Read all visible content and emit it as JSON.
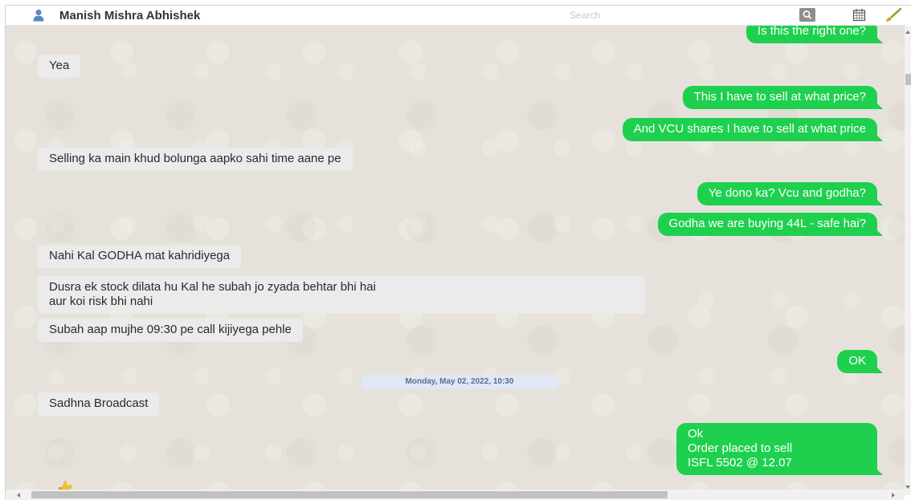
{
  "header": {
    "contact_name": "Manish Mishra Abhishek",
    "search_placeholder": "Search",
    "icons": [
      "contact-avatar-icon",
      "search-icon",
      "calendar-icon",
      "brush-icon"
    ]
  },
  "messages": [
    {
      "direction": "outgoing",
      "text": "Is this the right one?"
    },
    {
      "direction": "incoming",
      "text": "Yea"
    },
    {
      "direction": "outgoing",
      "text": "This I have to sell at what price?"
    },
    {
      "direction": "outgoing",
      "text": "And VCU shares I have to sell at what price"
    },
    {
      "direction": "incoming",
      "text": "Selling ka main khud bolunga aapko sahi time aane pe"
    },
    {
      "direction": "outgoing",
      "text": "Ye dono ka? Vcu and godha?"
    },
    {
      "direction": "outgoing",
      "text": "Godha we are buying 44L - safe hai?"
    },
    {
      "direction": "incoming",
      "text": "Nahi Kal GODHA mat kahridiyega"
    },
    {
      "direction": "incoming",
      "lines": [
        "Dusra ek stock dilata hu Kal he subah jo zyada behtar bhi hai",
        "aur koi risk bhi nahi"
      ]
    },
    {
      "direction": "incoming",
      "text": "Subah aap mujhe 09:30 pe call kijiyega pehle"
    },
    {
      "direction": "outgoing",
      "text": "OK"
    },
    {
      "direction": "incoming",
      "text": "Sadhna Broadcast"
    },
    {
      "direction": "outgoing",
      "lines": [
        "Ok",
        "Order placed to sell",
        "ISFL 5502 @ 12.07"
      ]
    }
  ],
  "date_separator": "Monday, May 02, 2022, 10:30",
  "colors": {
    "outgoing_bubble": "#1fd04e",
    "incoming_bubble": "#ecebeb",
    "chat_background": "#e6e2db",
    "date_chip": "#e0e8f3"
  }
}
